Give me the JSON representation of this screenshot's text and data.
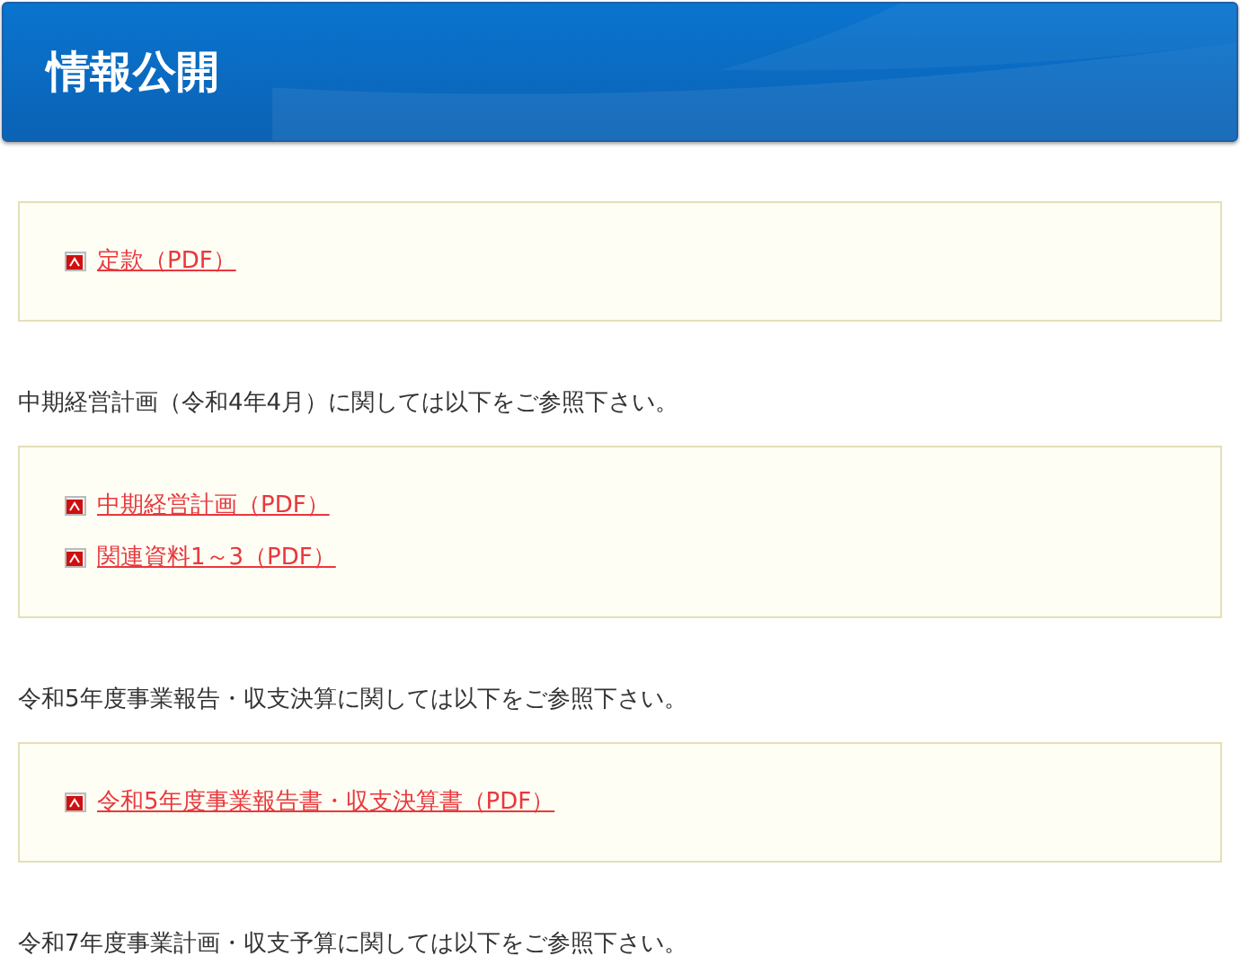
{
  "header": {
    "title": "情報公開"
  },
  "sections": [
    {
      "links": [
        {
          "label": "定款（PDF）"
        }
      ]
    },
    {
      "intro": "中期経営計画（令和4年4月）に関しては以下をご参照下さい。",
      "links": [
        {
          "label": "中期経営計画（PDF）"
        },
        {
          "label": "関連資料1～3（PDF）"
        }
      ]
    },
    {
      "intro": "令和5年度事業報告・収支決算に関しては以下をご参照下さい。",
      "links": [
        {
          "label": "令和5年度事業報告書・収支決算書（PDF）"
        }
      ]
    },
    {
      "intro": "令和7年度事業計画・収支予算に関しては以下をご参照下さい。"
    }
  ]
}
